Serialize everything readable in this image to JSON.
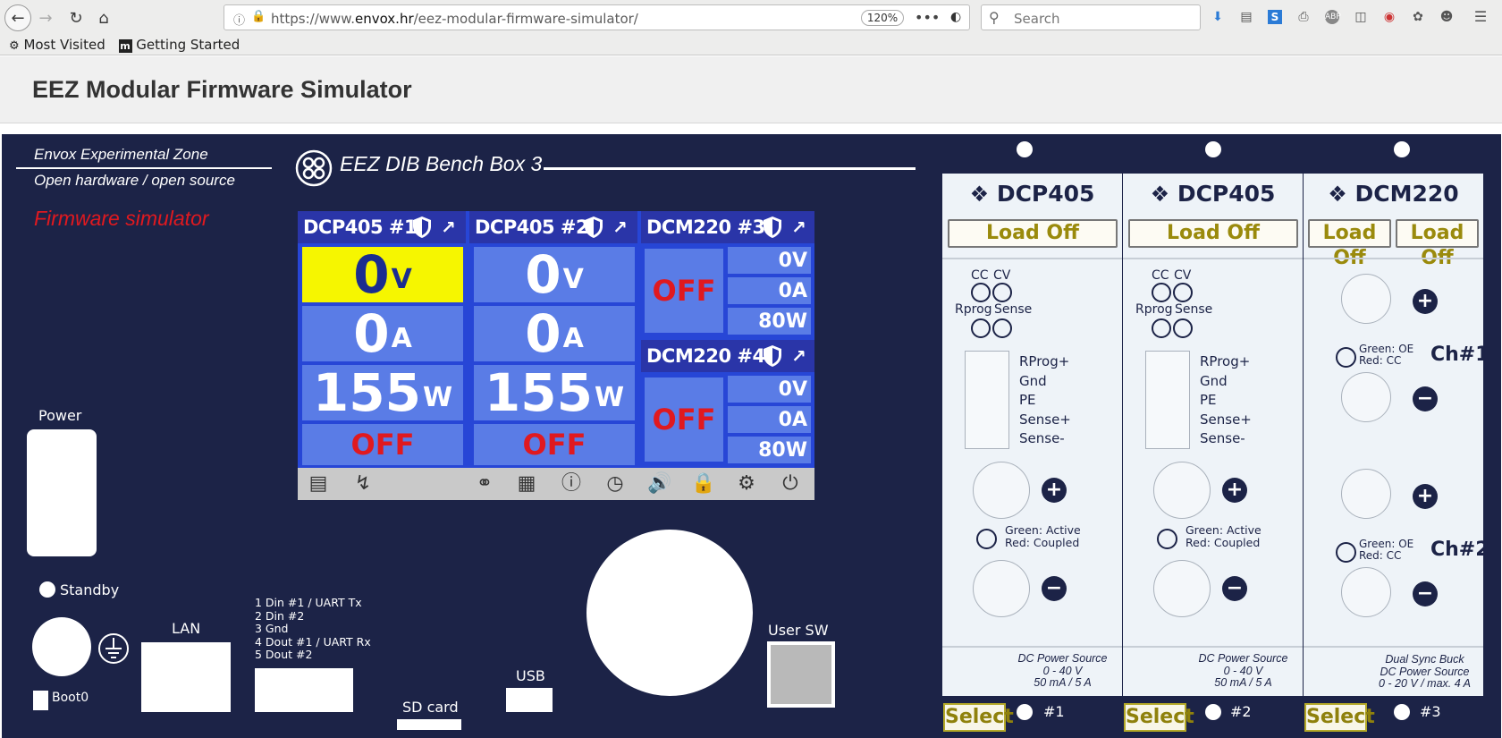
{
  "browser": {
    "url_prefix": "https://www.",
    "url_domain": "envox.hr",
    "url_path": "/eez-modular-firmware-simulator/",
    "zoom": "120%",
    "search_placeholder": "Search",
    "bookmarks": [
      "Most Visited",
      "Getting Started"
    ]
  },
  "site": {
    "title": "EEZ Modular Firmware Simulator"
  },
  "panel": {
    "brand1": "Envox Experimental Zone",
    "brand2": "Open hardware / open source",
    "sim_label": "Firmware simulator",
    "product": "EEZ DIB Bench Box 3",
    "power": "Power",
    "standby": "Standby",
    "boot0": "Boot0",
    "lan": "LAN",
    "pins": [
      "1 Din #1 / UART Tx",
      "2 Din #2",
      "3 Gnd",
      "4 Dout #1 / UART Rx",
      "5 Dout #2"
    ],
    "sdcard": "SD card",
    "usb": "USB",
    "usersw": "User SW"
  },
  "display": {
    "ch1": {
      "title": "DCP405 #1",
      "v": "0",
      "v_unit": "V",
      "a": "0",
      "a_unit": "A",
      "w": "155",
      "w_unit": "W",
      "state": "OFF"
    },
    "ch2": {
      "title": "DCP405 #2",
      "v": "0",
      "v_unit": "V",
      "a": "0",
      "a_unit": "A",
      "w": "155",
      "w_unit": "W",
      "state": "OFF"
    },
    "ch3": {
      "title": "DCM220 #3",
      "state": "OFF",
      "v": "0V",
      "a": "0A",
      "w": "80W"
    },
    "ch4": {
      "title": "DCM220 #4",
      "state": "OFF",
      "v": "0V",
      "a": "0A",
      "w": "80W"
    },
    "colors": {
      "lcd": "#2746d6",
      "cell": "#5a7ce6",
      "highlight": "#f6f600",
      "off": "#e0191f"
    }
  },
  "modules": [
    {
      "name": "DCP405",
      "load": "Load Off",
      "cc": "CC",
      "cv": "CV",
      "rprog": "Rprog",
      "sense": "Sense",
      "terminals": [
        "RProg+",
        "Gnd",
        "PE",
        "Sense+",
        "Sense-"
      ],
      "led_green": "Green: Active",
      "led_red": "Red: Coupled",
      "desc1": "DC Power Source",
      "desc2": "0 - 40 V",
      "desc3": "50 mA / 5 A",
      "select": "Select",
      "slot": "#1"
    },
    {
      "name": "DCP405",
      "load": "Load Off",
      "cc": "CC",
      "cv": "CV",
      "rprog": "Rprog",
      "sense": "Sense",
      "terminals": [
        "RProg+",
        "Gnd",
        "PE",
        "Sense+",
        "Sense-"
      ],
      "led_green": "Green: Active",
      "led_red": "Red: Coupled",
      "desc1": "DC Power Source",
      "desc2": "0 - 40 V",
      "desc3": "50 mA / 5 A",
      "select": "Select",
      "slot": "#2"
    },
    {
      "name": "DCM220",
      "load1": "Load Off",
      "load2": "Load Off",
      "ch1": "Ch#1",
      "ch2": "Ch#2",
      "led_green": "Green: OE",
      "led_red": "Red: CC",
      "desc1": "Dual Sync Buck",
      "desc2": "DC Power Source",
      "desc3": "0 - 20 V / max. 4 A",
      "select": "Select",
      "slot": "#3"
    }
  ]
}
